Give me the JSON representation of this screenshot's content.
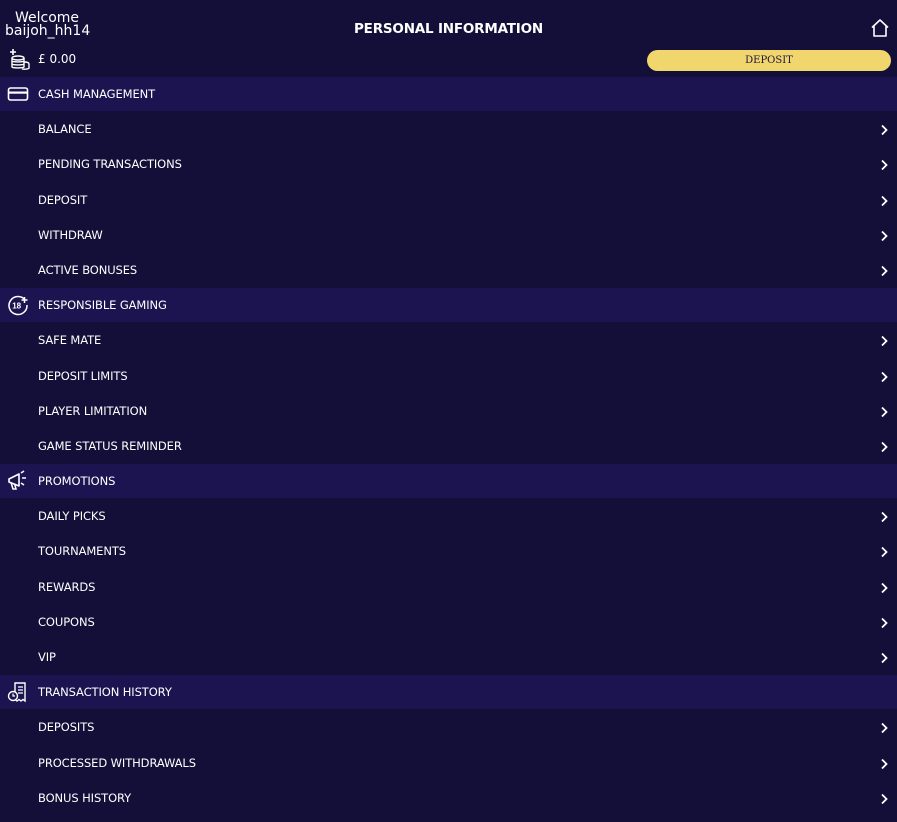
{
  "header": {
    "welcome": "Welcome",
    "username": "baijoh_hh14",
    "title": "PERSONAL INFORMATION",
    "balance": "£ 0.00",
    "deposit_label": "DEPOSIT",
    "home_icon": "home-icon",
    "coins_icon": "coins-icon"
  },
  "colors": {
    "background": "#130f38",
    "section_background": "#1b1450",
    "deposit_button": "#f0d66c",
    "text": "#ffffff"
  },
  "sections": [
    {
      "title": "CASH MANAGEMENT",
      "icon": "credit-card-icon",
      "items": [
        "BALANCE",
        "PENDING TRANSACTIONS",
        "DEPOSIT",
        "WITHDRAW",
        "ACTIVE BONUSES"
      ]
    },
    {
      "title": "RESPONSIBLE GAMING",
      "icon": "age-18-icon",
      "items": [
        "SAFE MATE",
        "DEPOSIT LIMITS",
        "PLAYER LIMITATION",
        "GAME STATUS REMINDER"
      ]
    },
    {
      "title": "PROMOTIONS",
      "icon": "megaphone-icon",
      "items": [
        "DAILY PICKS",
        "TOURNAMENTS",
        "REWARDS",
        "COUPONS",
        "VIP"
      ]
    },
    {
      "title": "TRANSACTION HISTORY",
      "icon": "receipt-clock-icon",
      "items": [
        "DEPOSITS",
        "PROCESSED WITHDRAWALS",
        "BONUS HISTORY"
      ]
    }
  ]
}
